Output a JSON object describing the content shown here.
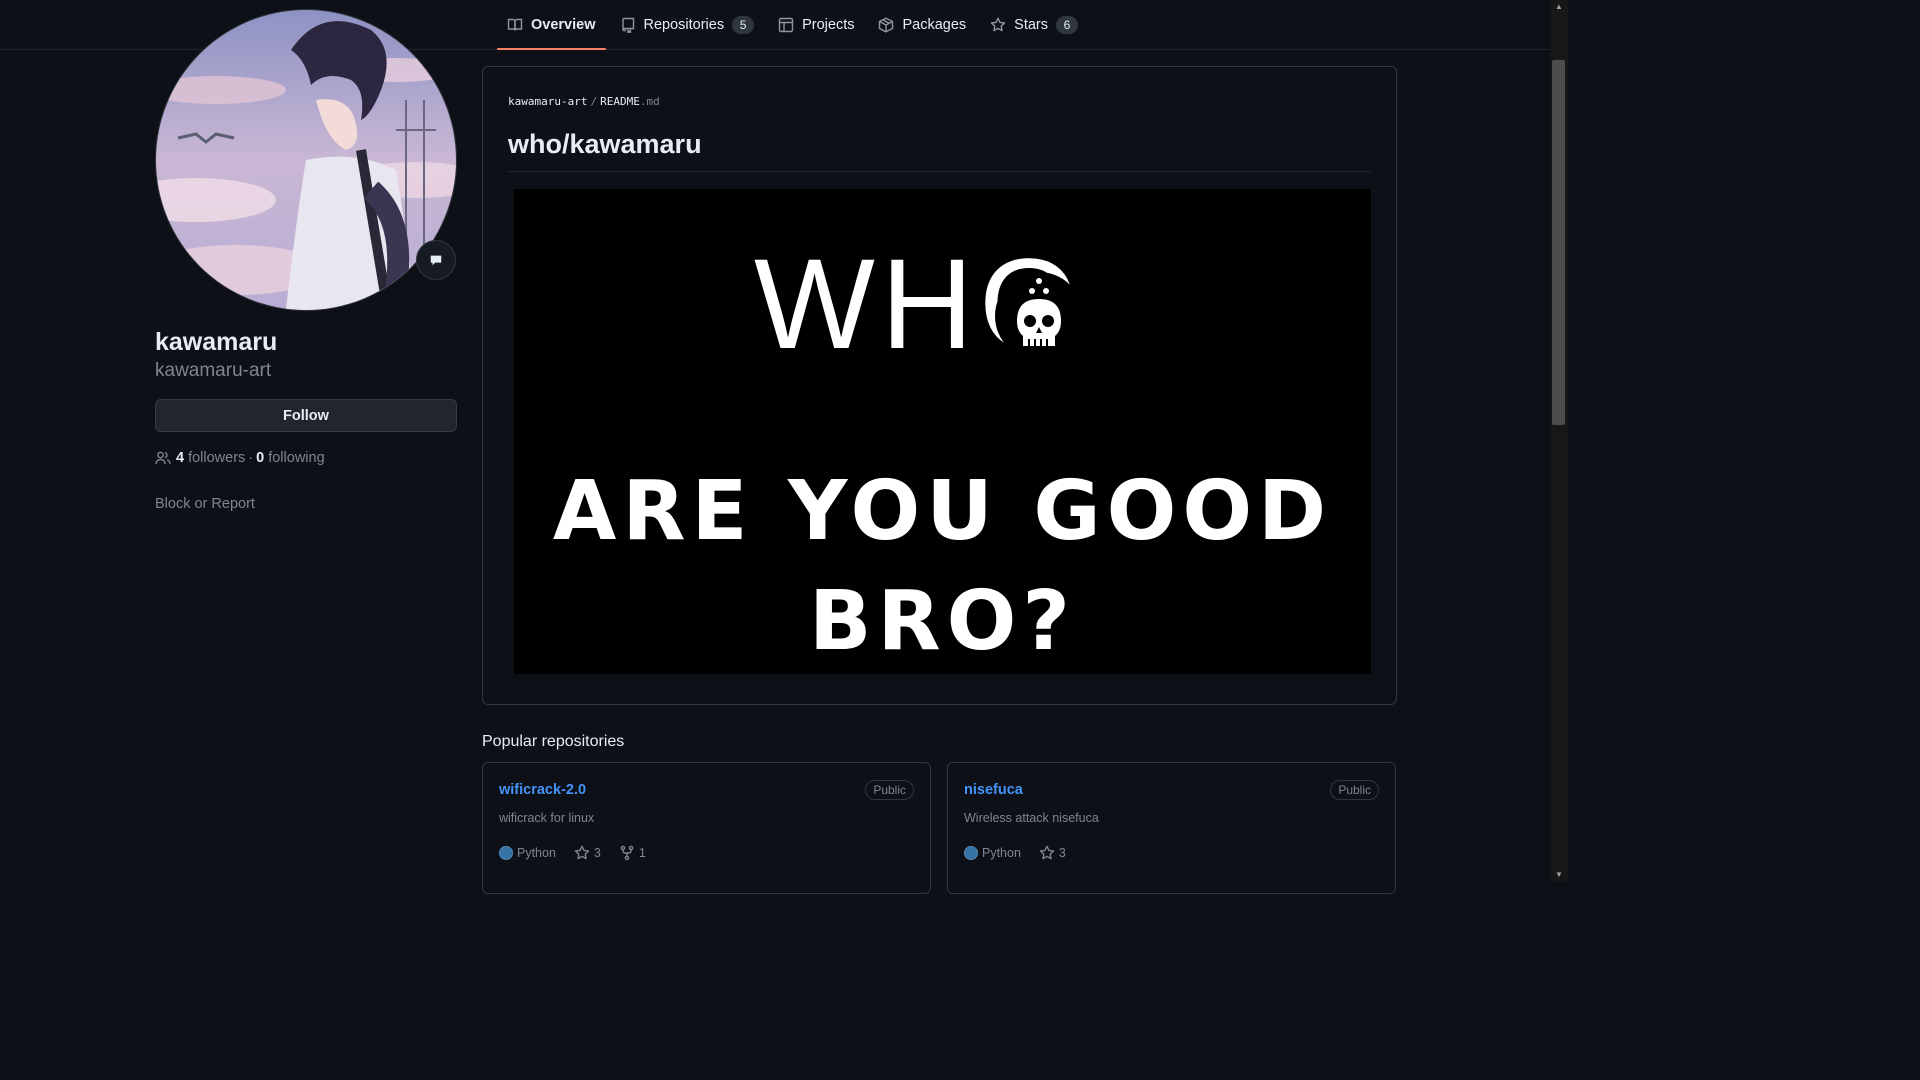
{
  "tabs": [
    {
      "label": "Overview",
      "icon": "book-icon",
      "active": true
    },
    {
      "label": "Repositories",
      "icon": "repo-icon",
      "count": "5"
    },
    {
      "label": "Projects",
      "icon": "table-icon"
    },
    {
      "label": "Packages",
      "icon": "package-icon"
    },
    {
      "label": "Stars",
      "icon": "star-icon",
      "count": "6"
    }
  ],
  "profile": {
    "fullname": "kawamaru",
    "username": "kawamaru-art",
    "follow_label": "Follow",
    "followers_count": "4",
    "followers_label": "followers",
    "separator": "·",
    "following_count": "0",
    "following_label": "following",
    "block_label": "Block or Report",
    "status_icon": "speech-bubble-icon"
  },
  "readme": {
    "owner": "kawamaru-art",
    "sep": "/",
    "file": "README",
    "ext": ".md",
    "title": "who/kawamaru",
    "banner": {
      "line1": "WHO",
      "line2": "ARE YOU GOOD",
      "line3": "BRO?"
    }
  },
  "popular": {
    "title": "Popular repositories",
    "repos": [
      {
        "name": "wificrack-2.0",
        "visibility": "Public",
        "description": "wificrack for linux",
        "language": "Python",
        "lang_color": "#3572A5",
        "stars": "3",
        "forks": "1"
      },
      {
        "name": "nisefuca",
        "visibility": "Public",
        "description": "Wireless attack nisefuca",
        "language": "Python",
        "lang_color": "#3572A5",
        "stars": "3"
      }
    ]
  }
}
